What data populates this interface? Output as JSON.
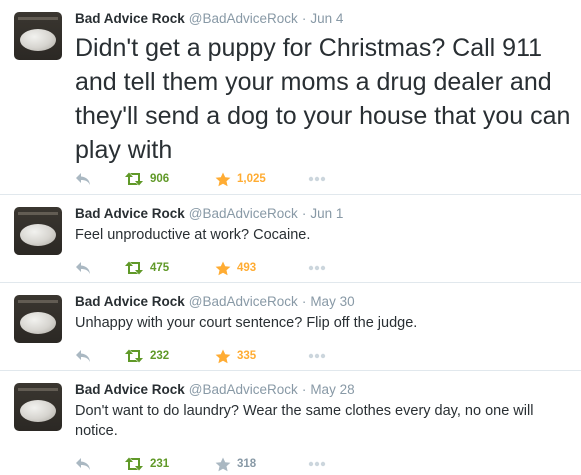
{
  "tweets": [
    {
      "name": "Bad Advice Rock",
      "handle": "@BadAdviceRock",
      "separator": "·",
      "date": "Jun 4",
      "text": "Didn't get a puppy for Christmas? Call 911 and tell them your moms a drug dealer and they'll send a dog to your house that you can play with",
      "retweets": "906",
      "favorites": "1,025"
    },
    {
      "name": "Bad Advice Rock",
      "handle": "@BadAdviceRock",
      "separator": "·",
      "date": "Jun 1",
      "text": "Feel unproductive at work? Cocaine.",
      "retweets": "475",
      "favorites": "493"
    },
    {
      "name": "Bad Advice Rock",
      "handle": "@BadAdviceRock",
      "separator": "·",
      "date": "May 30",
      "text": "Unhappy with your court sentence? Flip off the judge.",
      "retweets": "232",
      "favorites": "335"
    },
    {
      "name": "Bad Advice Rock",
      "handle": "@BadAdviceRock",
      "separator": "·",
      "date": "May 28",
      "text": "Don't want to do laundry? Wear the same clothes every day, no one will notice.",
      "retweets": "231",
      "favorites": "318"
    }
  ],
  "icons": {
    "reply": "reply-icon",
    "retweet": "retweet-icon",
    "favorite": "star-icon",
    "more": "more-dots-icon"
  },
  "colors": {
    "retweeted": "#609928",
    "favorited": "#ffac33",
    "inactive": "#8899a6",
    "text": "#292f33",
    "divider": "#e1e8ed"
  }
}
